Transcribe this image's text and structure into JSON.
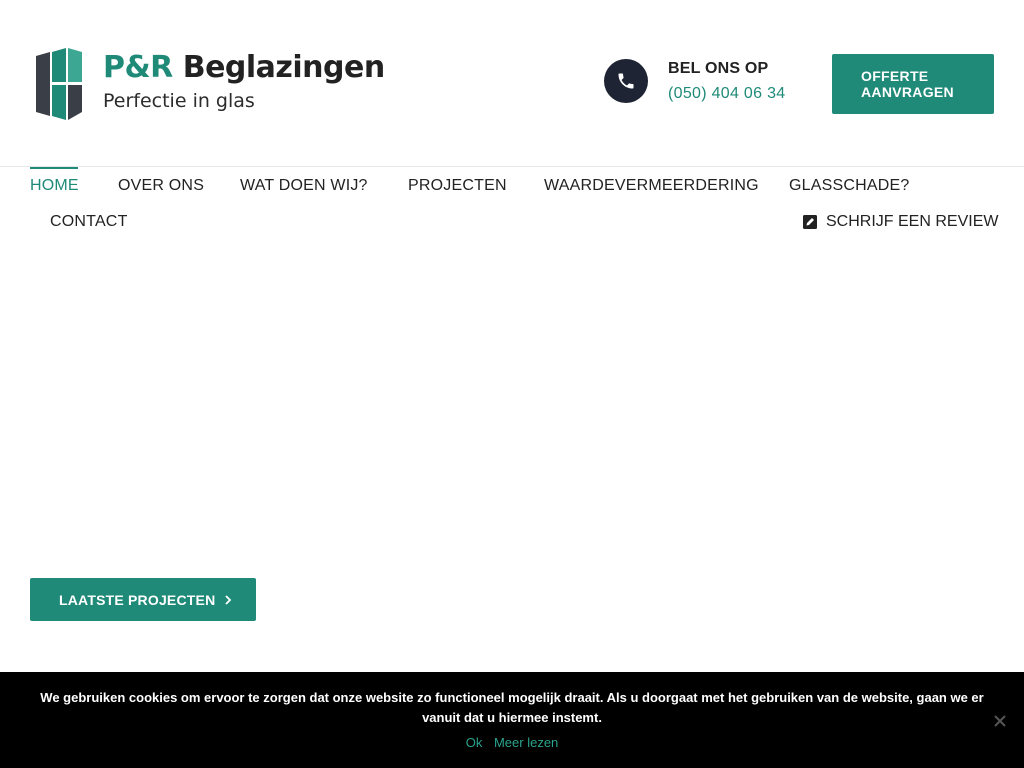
{
  "colors": {
    "accent": "#1f8a78",
    "dark": "#1e2433",
    "text": "#222222",
    "cookie_bg": "#000000",
    "cookie_link": "#2aa38c"
  },
  "header": {
    "logo": {
      "brand_prefix": "P&R",
      "brand_suffix": "Beglazingen",
      "tagline": "Perfectie in glas",
      "icon": "window-panes-logo"
    },
    "call": {
      "icon": "phone-icon",
      "label": "BEL ONS OP",
      "number": "(050) 404 06 34"
    },
    "offerte_button": {
      "line1": "OFFERTE",
      "line2": "AANVRAGEN"
    }
  },
  "nav": {
    "items": [
      {
        "label": "HOME",
        "active": true
      },
      {
        "label": "OVER ONS",
        "active": false
      },
      {
        "label": "WAT DOEN WIJ?",
        "active": false
      },
      {
        "label": "PROJECTEN",
        "active": false
      },
      {
        "label": "WAARDEVERMEERDERING",
        "active": false
      },
      {
        "label": "GLASSCHADE?",
        "active": false
      },
      {
        "label": "CONTACT",
        "active": false
      }
    ],
    "review": {
      "icon": "edit-square-icon",
      "label": "SCHRIJF EEN REVIEW"
    }
  },
  "hero": {
    "cta": {
      "label": "LAATSTE PROJECTEN",
      "icon": "chevron-right-icon"
    }
  },
  "cookie_banner": {
    "message": "We gebruiken cookies om ervoor te zorgen dat onze website zo functioneel mogelijk draait. Als u doorgaat met het gebruiken van de website, gaan we er vanuit dat u hiermee instemt.",
    "ok_label": "Ok",
    "more_label": "Meer lezen",
    "close_icon": "close-icon"
  }
}
